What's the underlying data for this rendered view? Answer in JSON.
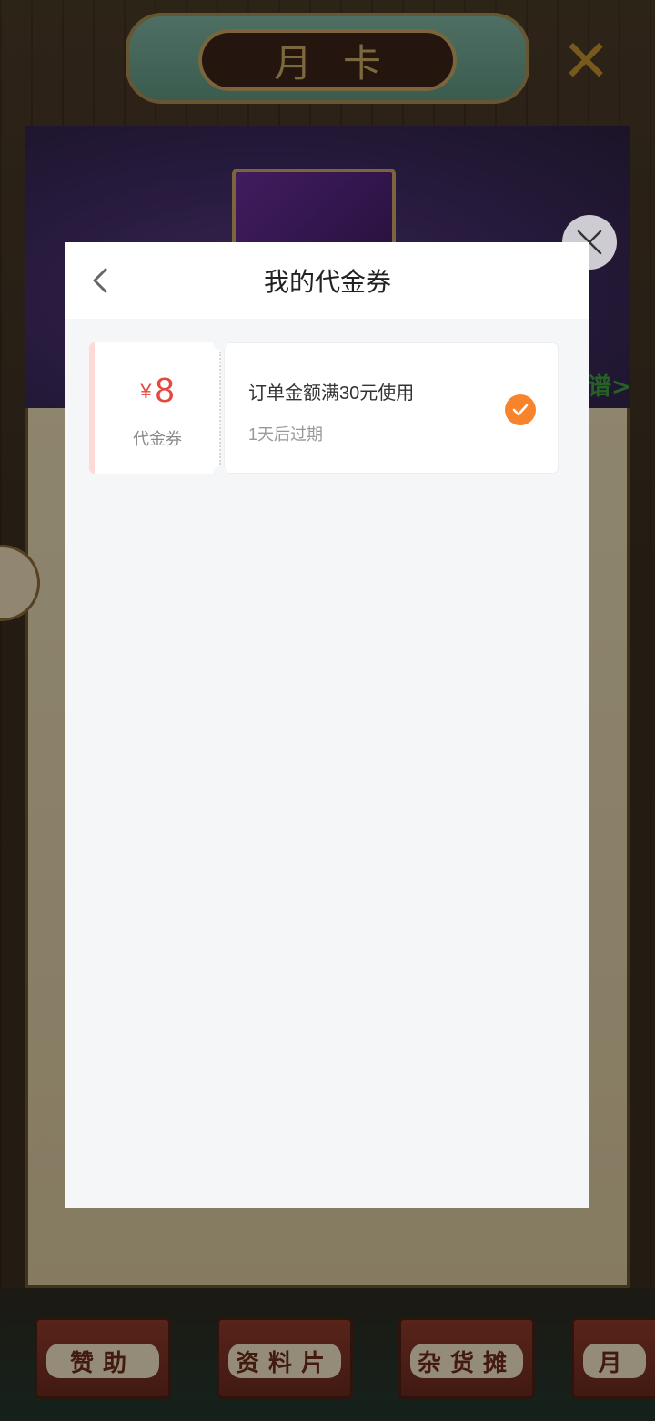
{
  "background": {
    "title": "月卡",
    "side_link_text": "谱",
    "bottom_tabs": [
      "赞助",
      "资料片",
      "杂货摊",
      "月"
    ]
  },
  "modal": {
    "title": "我的代金券",
    "vouchers": [
      {
        "currency_symbol": "¥",
        "amount": "8",
        "type_label": "代金券",
        "condition": "订单金额满30元使用",
        "expiry": "1天后过期",
        "selected": true
      }
    ]
  },
  "colors": {
    "amount": "#e4483f",
    "check": "#f7842d",
    "modal_bg": "#f5f6f8"
  }
}
